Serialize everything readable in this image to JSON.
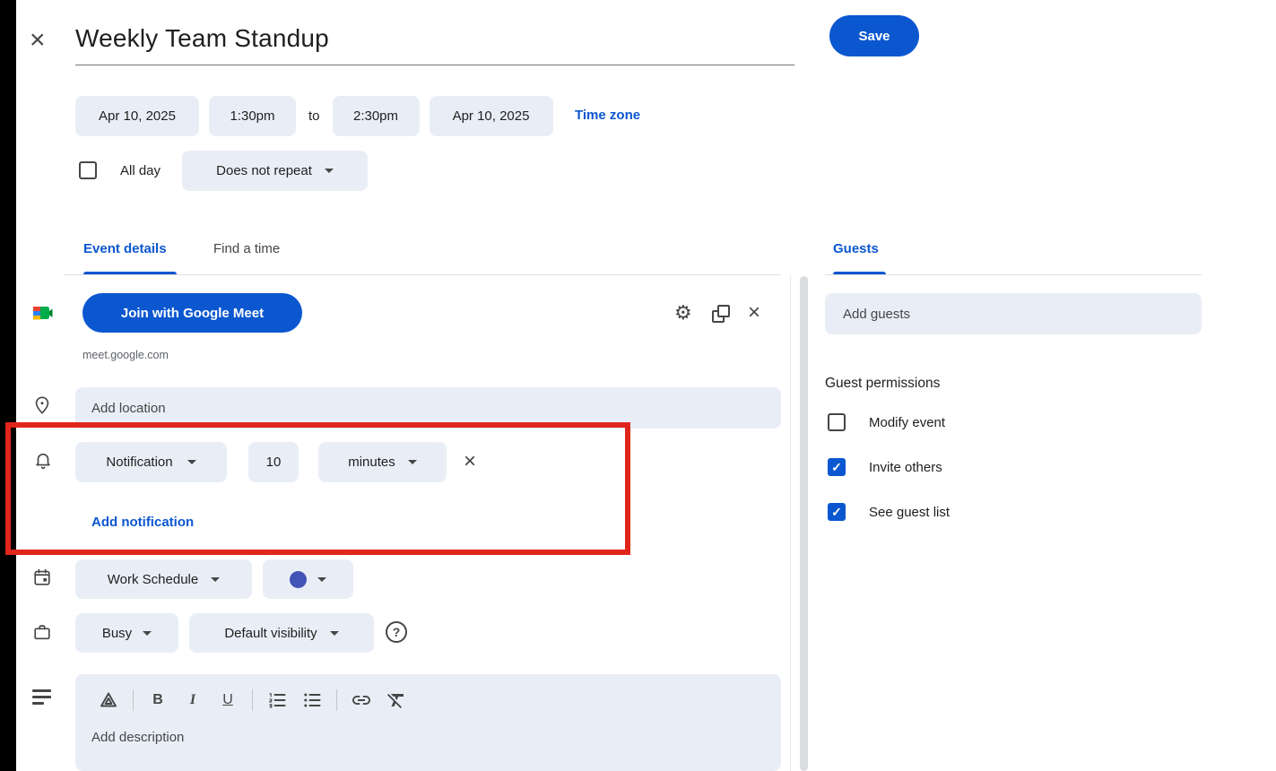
{
  "colors": {
    "accent_blue": "#0b57d0",
    "chip_background": "#e9eef6",
    "highlight_red": "#e0261c",
    "calendar_color": "#4254b5",
    "icon_gray": "#444746"
  },
  "header": {
    "title": "Weekly Team Standup",
    "save_label": "Save"
  },
  "icons": {
    "close": "×",
    "gear": "⚙",
    "check": "✓",
    "remove": "×",
    "help": "?"
  },
  "datetime": {
    "start_date": "Apr 10, 2025",
    "start_time": "1:30pm",
    "to": "to",
    "end_time": "2:30pm",
    "end_date": "Apr 10, 2025",
    "timezone_label": "Time zone",
    "all_day_label": "All day",
    "recurrence": "Does not repeat"
  },
  "tabs": {
    "event_details": "Event details",
    "find_a_time": "Find a time",
    "guests": "Guests"
  },
  "meet": {
    "join_label": "Join with Google Meet",
    "url": "meet.google.com"
  },
  "location": {
    "placeholder": "Add location"
  },
  "notification": {
    "type": "Notification",
    "value": "10",
    "unit": "minutes",
    "add_label": "Add notification"
  },
  "calendar": {
    "name": "Work Schedule",
    "color_style": "background-color:#4254b5"
  },
  "availability": {
    "status": "Busy",
    "visibility": "Default visibility"
  },
  "description": {
    "placeholder": "Add description",
    "bold": "B",
    "italic": "I",
    "underline": "U"
  },
  "guests": {
    "placeholder": "Add guests",
    "permissions_title": "Guest permissions",
    "permissions": [
      {
        "label": "Modify event",
        "checked": false
      },
      {
        "label": "Invite others",
        "checked": true
      },
      {
        "label": "See guest list",
        "checked": true
      }
    ]
  }
}
